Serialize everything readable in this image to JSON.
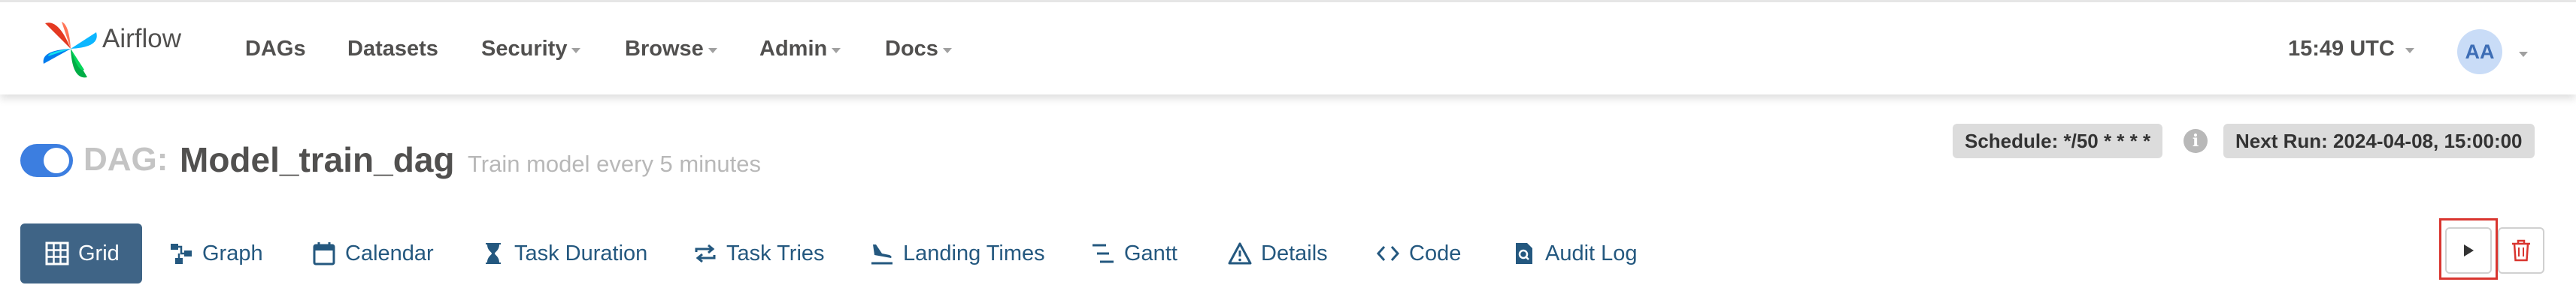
{
  "brand": {
    "name": "Airflow",
    "icon": "airflow-pinwheel-icon"
  },
  "nav": {
    "items": [
      {
        "label": "DAGs",
        "dropdown": false
      },
      {
        "label": "Datasets",
        "dropdown": false
      },
      {
        "label": "Security",
        "dropdown": true
      },
      {
        "label": "Browse",
        "dropdown": true
      },
      {
        "label": "Admin",
        "dropdown": true
      },
      {
        "label": "Docs",
        "dropdown": true
      }
    ],
    "time": "15:49 UTC",
    "user_initials": "AA"
  },
  "dag": {
    "prefix": "DAG:",
    "name": "Model_train_dag",
    "description": "Train model every 5 minutes",
    "schedule": "Schedule: */50 * * * *",
    "next_run": "Next Run: 2024-04-08, 15:00:00",
    "paused": false
  },
  "tabs": [
    {
      "label": "Grid",
      "icon": "grid-icon",
      "active": true
    },
    {
      "label": "Graph",
      "icon": "graph-icon"
    },
    {
      "label": "Calendar",
      "icon": "calendar-icon"
    },
    {
      "label": "Task Duration",
      "icon": "hourglass-icon"
    },
    {
      "label": "Task Tries",
      "icon": "repeat-icon"
    },
    {
      "label": "Landing Times",
      "icon": "plane-landing-icon"
    },
    {
      "label": "Gantt",
      "icon": "gantt-icon"
    },
    {
      "label": "Details",
      "icon": "warning-triangle-icon"
    },
    {
      "label": "Code",
      "icon": "code-icon"
    },
    {
      "label": "Audit Log",
      "icon": "search-document-icon"
    }
  ],
  "actions": {
    "trigger_icon": "play-icon",
    "delete_icon": "trash-icon"
  },
  "colors": {
    "accent": "#3c7ee0",
    "tab_active_bg": "#3f6486",
    "tab_text": "#24587f",
    "delete_red": "#d9352f",
    "highlight_border": "#d9352f"
  }
}
